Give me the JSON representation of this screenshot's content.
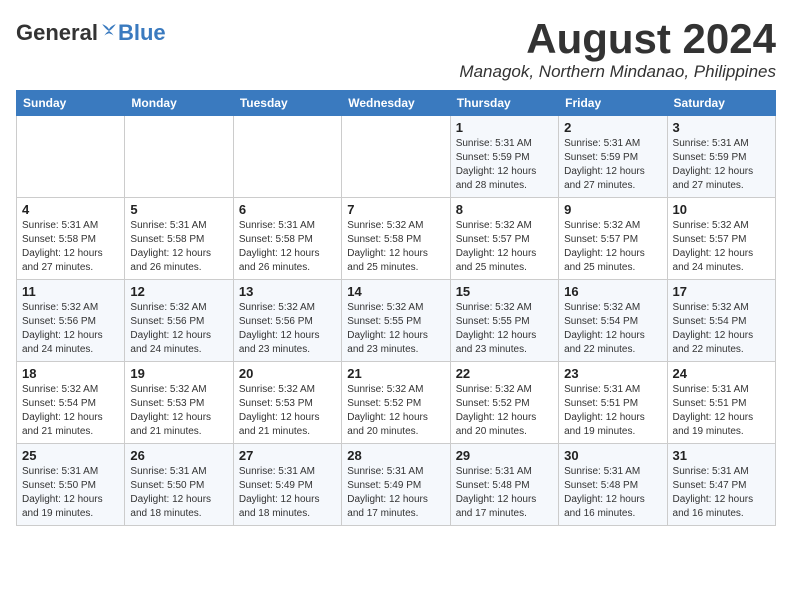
{
  "logo": {
    "general": "General",
    "blue": "Blue"
  },
  "header": {
    "month": "August 2024",
    "location": "Managok, Northern Mindanao, Philippines"
  },
  "weekdays": [
    "Sunday",
    "Monday",
    "Tuesday",
    "Wednesday",
    "Thursday",
    "Friday",
    "Saturday"
  ],
  "weeks": [
    [
      {
        "day": "",
        "detail": ""
      },
      {
        "day": "",
        "detail": ""
      },
      {
        "day": "",
        "detail": ""
      },
      {
        "day": "",
        "detail": ""
      },
      {
        "day": "1",
        "detail": "Sunrise: 5:31 AM\nSunset: 5:59 PM\nDaylight: 12 hours\nand 28 minutes."
      },
      {
        "day": "2",
        "detail": "Sunrise: 5:31 AM\nSunset: 5:59 PM\nDaylight: 12 hours\nand 27 minutes."
      },
      {
        "day": "3",
        "detail": "Sunrise: 5:31 AM\nSunset: 5:59 PM\nDaylight: 12 hours\nand 27 minutes."
      }
    ],
    [
      {
        "day": "4",
        "detail": "Sunrise: 5:31 AM\nSunset: 5:58 PM\nDaylight: 12 hours\nand 27 minutes."
      },
      {
        "day": "5",
        "detail": "Sunrise: 5:31 AM\nSunset: 5:58 PM\nDaylight: 12 hours\nand 26 minutes."
      },
      {
        "day": "6",
        "detail": "Sunrise: 5:31 AM\nSunset: 5:58 PM\nDaylight: 12 hours\nand 26 minutes."
      },
      {
        "day": "7",
        "detail": "Sunrise: 5:32 AM\nSunset: 5:58 PM\nDaylight: 12 hours\nand 25 minutes."
      },
      {
        "day": "8",
        "detail": "Sunrise: 5:32 AM\nSunset: 5:57 PM\nDaylight: 12 hours\nand 25 minutes."
      },
      {
        "day": "9",
        "detail": "Sunrise: 5:32 AM\nSunset: 5:57 PM\nDaylight: 12 hours\nand 25 minutes."
      },
      {
        "day": "10",
        "detail": "Sunrise: 5:32 AM\nSunset: 5:57 PM\nDaylight: 12 hours\nand 24 minutes."
      }
    ],
    [
      {
        "day": "11",
        "detail": "Sunrise: 5:32 AM\nSunset: 5:56 PM\nDaylight: 12 hours\nand 24 minutes."
      },
      {
        "day": "12",
        "detail": "Sunrise: 5:32 AM\nSunset: 5:56 PM\nDaylight: 12 hours\nand 24 minutes."
      },
      {
        "day": "13",
        "detail": "Sunrise: 5:32 AM\nSunset: 5:56 PM\nDaylight: 12 hours\nand 23 minutes."
      },
      {
        "day": "14",
        "detail": "Sunrise: 5:32 AM\nSunset: 5:55 PM\nDaylight: 12 hours\nand 23 minutes."
      },
      {
        "day": "15",
        "detail": "Sunrise: 5:32 AM\nSunset: 5:55 PM\nDaylight: 12 hours\nand 23 minutes."
      },
      {
        "day": "16",
        "detail": "Sunrise: 5:32 AM\nSunset: 5:54 PM\nDaylight: 12 hours\nand 22 minutes."
      },
      {
        "day": "17",
        "detail": "Sunrise: 5:32 AM\nSunset: 5:54 PM\nDaylight: 12 hours\nand 22 minutes."
      }
    ],
    [
      {
        "day": "18",
        "detail": "Sunrise: 5:32 AM\nSunset: 5:54 PM\nDaylight: 12 hours\nand 21 minutes."
      },
      {
        "day": "19",
        "detail": "Sunrise: 5:32 AM\nSunset: 5:53 PM\nDaylight: 12 hours\nand 21 minutes."
      },
      {
        "day": "20",
        "detail": "Sunrise: 5:32 AM\nSunset: 5:53 PM\nDaylight: 12 hours\nand 21 minutes."
      },
      {
        "day": "21",
        "detail": "Sunrise: 5:32 AM\nSunset: 5:52 PM\nDaylight: 12 hours\nand 20 minutes."
      },
      {
        "day": "22",
        "detail": "Sunrise: 5:32 AM\nSunset: 5:52 PM\nDaylight: 12 hours\nand 20 minutes."
      },
      {
        "day": "23",
        "detail": "Sunrise: 5:31 AM\nSunset: 5:51 PM\nDaylight: 12 hours\nand 19 minutes."
      },
      {
        "day": "24",
        "detail": "Sunrise: 5:31 AM\nSunset: 5:51 PM\nDaylight: 12 hours\nand 19 minutes."
      }
    ],
    [
      {
        "day": "25",
        "detail": "Sunrise: 5:31 AM\nSunset: 5:50 PM\nDaylight: 12 hours\nand 19 minutes."
      },
      {
        "day": "26",
        "detail": "Sunrise: 5:31 AM\nSunset: 5:50 PM\nDaylight: 12 hours\nand 18 minutes."
      },
      {
        "day": "27",
        "detail": "Sunrise: 5:31 AM\nSunset: 5:49 PM\nDaylight: 12 hours\nand 18 minutes."
      },
      {
        "day": "28",
        "detail": "Sunrise: 5:31 AM\nSunset: 5:49 PM\nDaylight: 12 hours\nand 17 minutes."
      },
      {
        "day": "29",
        "detail": "Sunrise: 5:31 AM\nSunset: 5:48 PM\nDaylight: 12 hours\nand 17 minutes."
      },
      {
        "day": "30",
        "detail": "Sunrise: 5:31 AM\nSunset: 5:48 PM\nDaylight: 12 hours\nand 16 minutes."
      },
      {
        "day": "31",
        "detail": "Sunrise: 5:31 AM\nSunset: 5:47 PM\nDaylight: 12 hours\nand 16 minutes."
      }
    ]
  ]
}
